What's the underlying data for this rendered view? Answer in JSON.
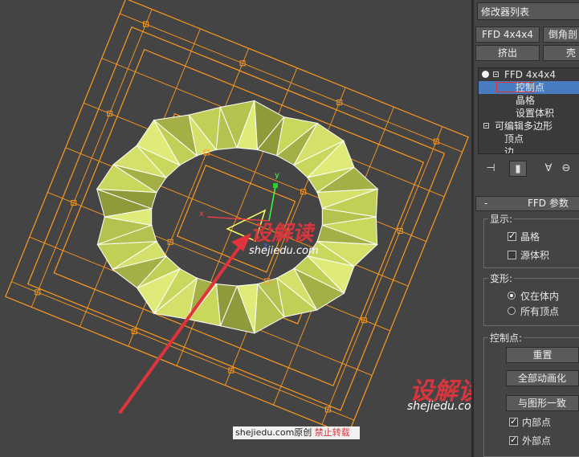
{
  "modifier_list": {
    "label": "修改器列表"
  },
  "buttons": {
    "ffd_4x4x4": "FFD 4x4x4",
    "chamfer": "倒角剖",
    "extrude": "挤出",
    "shell": "壳"
  },
  "stack": {
    "items": [
      {
        "label": "FFD 4x4x4"
      },
      {
        "label": "控制点"
      },
      {
        "label": "晶格"
      },
      {
        "label": "设置体积"
      },
      {
        "label": "可编辑多边形"
      },
      {
        "label": "顶点"
      },
      {
        "label": "边"
      }
    ],
    "selected_index": 1
  },
  "toolbar": {
    "icons": [
      "pin-stack-icon",
      "show-end-result-icon",
      "make-unique-icon",
      "remove-modifier-icon"
    ]
  },
  "ffd_params": {
    "title": "FFD 参数",
    "collapse_symbol": "-",
    "display": {
      "label": "显示:",
      "lattice": {
        "label": "晶格",
        "checked": true
      },
      "source_volume": {
        "label": "源体积",
        "checked": false
      }
    },
    "deform": {
      "label": "变形:",
      "only_in_volume": {
        "label": "仅在体内",
        "selected": true
      },
      "all_vertices": {
        "label": "所有顶点",
        "selected": false
      }
    },
    "control_points": {
      "label": "控制点:",
      "reset": "重置",
      "animate_all": "全部动画化",
      "conform_to_shape": "与图形一致",
      "inside_points": {
        "label": "内部点",
        "checked": true
      },
      "outside_points": {
        "label": "外部点",
        "checked": true
      }
    }
  },
  "viewport": {
    "gizmo_axis_x": "x",
    "gizmo_axis_y": "y",
    "gizmo_axis_z": "z",
    "colors": {
      "mesh_fill": "#c6d45a",
      "lattice": "#ff9a1e",
      "wire": "#ffffff",
      "background": "#444444",
      "arrow": "#e0343c"
    }
  },
  "watermarks": {
    "center_main": "设解读",
    "center_sub": "shejiedu.com",
    "right_main": "设解读",
    "right_sub": "shejiedu.com",
    "footer_site": "shejiedu.com原创",
    "footer_notice": "禁止转载"
  }
}
